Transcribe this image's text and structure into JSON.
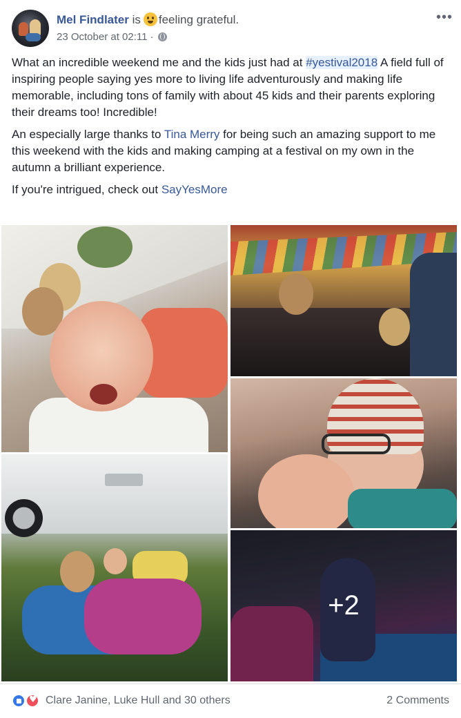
{
  "header": {
    "author_name": "Mel Findlater",
    "is_word": "is",
    "feeling_text": "feeling grateful.",
    "feeling_icon": "grateful-emoji-icon",
    "timestamp": "23 October at 02:11 ·",
    "privacy_icon": "globe-icon",
    "more_label": "•••"
  },
  "body": {
    "p1_before": "What an incredible weekend me and the kids just had at ",
    "hashtag": "#yestival2018",
    "p1_after": " A field full of inspiring people saying yes more to living life adventurously and making life memorable, including tons of family with about 45 kids and their parents exploring their dreams too! Incredible!",
    "p2_before": "An especially large thanks to ",
    "p2_mention": "Tina Merry",
    "p2_after": " for being such an amazing support to me this weekend with the kids and making camping at a festival on my own in the autumn a brilliant experience.",
    "p3_before": "If you're intrigued, check out ",
    "p3_link": "SayYesMore"
  },
  "photos": {
    "more_count": "+2"
  },
  "footer": {
    "reactions": [
      "like-icon",
      "love-icon"
    ],
    "reaction_names": "Clare Janine, Luke Hull and 30 others",
    "comments": "2 Comments"
  },
  "colors": {
    "link": "#385898",
    "hashtag_bg": "#e7f0fd",
    "like": "#3578e5",
    "love": "#f0505a",
    "meta_text": "#606770"
  }
}
